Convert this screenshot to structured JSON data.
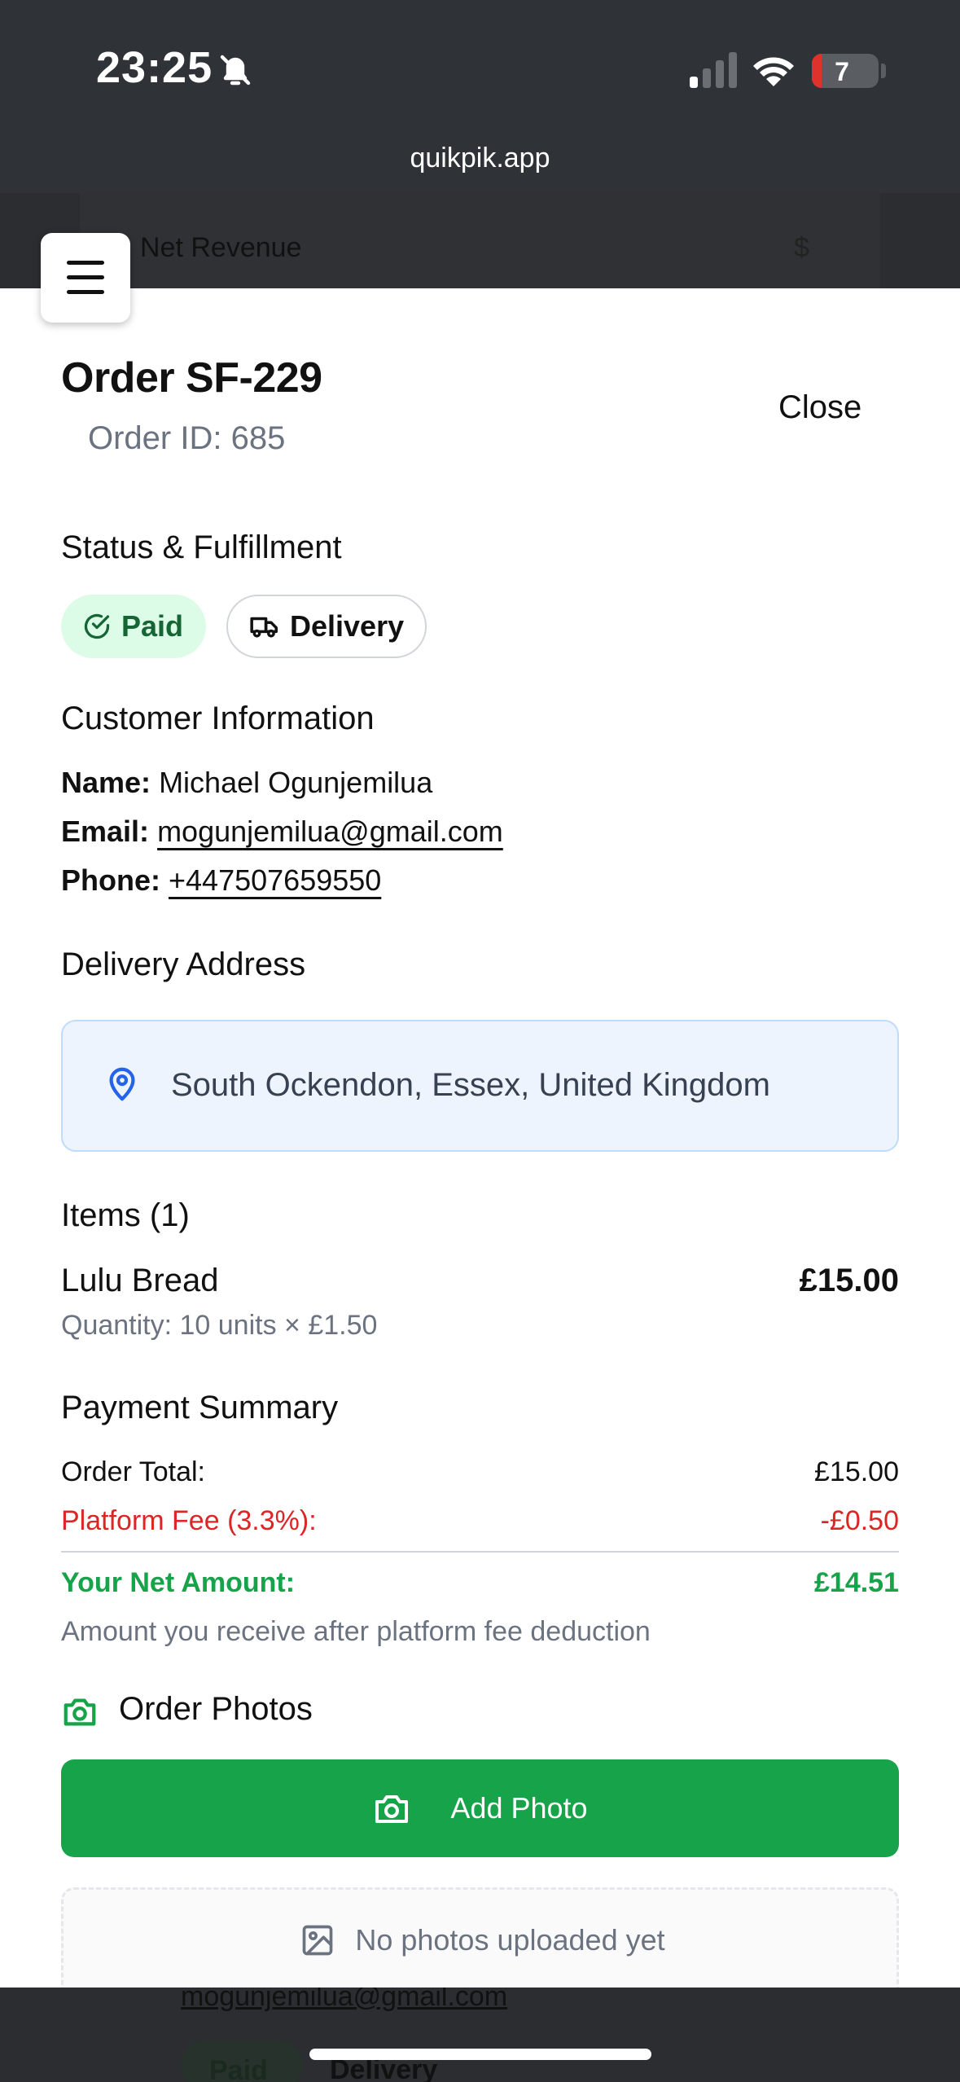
{
  "status_bar": {
    "time": "23:25",
    "battery": "7",
    "icons": [
      "bell-slash-icon",
      "signal-icon",
      "wifi-icon",
      "battery-icon"
    ]
  },
  "browser": {
    "url": "quikpik.app"
  },
  "background": {
    "revenue_label": "Net Revenue",
    "currency_symbol": "$",
    "email": "mogunjemilua@gmail.com",
    "paid": "Paid",
    "delivery": "Delivery"
  },
  "modal": {
    "title": "Order SF-229",
    "order_id": "Order ID: 685",
    "close_label": "Close",
    "status": {
      "heading": "Status & Fulfillment",
      "paid_label": "Paid",
      "delivery_label": "Delivery"
    },
    "customer": {
      "heading": "Customer Information",
      "name_label": "Name:",
      "name": "Michael Ogunjemilua",
      "email_label": "Email:",
      "email": "mogunjemilua@gmail.com",
      "phone_label": "Phone:",
      "phone": "+447507659550"
    },
    "address": {
      "heading": "Delivery Address",
      "text": "South Ockendon, Essex, United Kingdom"
    },
    "items": {
      "heading": "Items (1)",
      "list": [
        {
          "name": "Lulu Bread",
          "price": "£15.00",
          "quantity": "Quantity: 10 units × £1.50"
        }
      ]
    },
    "payment": {
      "heading": "Payment Summary",
      "order_total_label": "Order Total:",
      "order_total": "£15.00",
      "fee_label": "Platform Fee (3.3%):",
      "fee": "-£0.50",
      "net_label": "Your Net Amount:",
      "net": "£14.51",
      "note": "Amount you receive after platform fee deduction"
    },
    "photos": {
      "heading": "Order Photos",
      "add_label": "Add Photo",
      "empty_text": "No photos uploaded yet"
    }
  },
  "colors": {
    "accent_green": "#16a34a",
    "paid_bg": "#dcfce7",
    "fee_red": "#dc2626",
    "net_green": "#16a34a",
    "address_bg": "#eef4fe"
  }
}
